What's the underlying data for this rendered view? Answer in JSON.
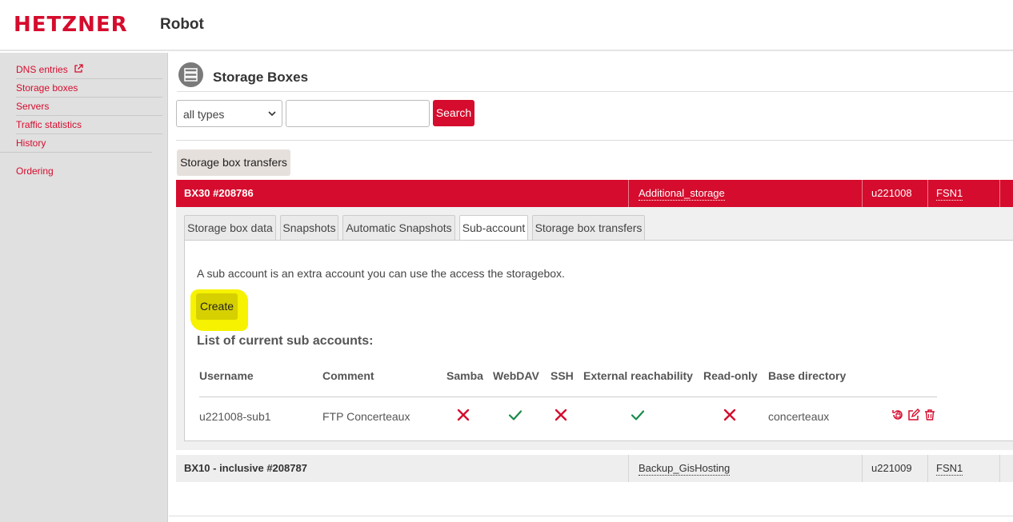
{
  "header": {
    "logo": "HETZNER",
    "product": "Robot"
  },
  "sidebar": {
    "items": [
      {
        "label": "DNS entries"
      },
      {
        "label": "Storage boxes"
      },
      {
        "label": "Servers"
      },
      {
        "label": "Traffic statistics"
      },
      {
        "label": "History"
      },
      {
        "label": "Ordering"
      }
    ]
  },
  "page": {
    "title": "Storage Boxes",
    "icon": "server-stack-icon"
  },
  "filter": {
    "type_selected": "all types",
    "search_value": "",
    "search_label": "Search"
  },
  "transfers_button": "Storage box transfers",
  "boxes": [
    {
      "title": "BX30 #208786",
      "name": "Additional_storage",
      "user": "u221008",
      "location": "FSN1"
    },
    {
      "title": "BX10 - inclusive #208787",
      "name": "Backup_GisHosting",
      "user": "u221009",
      "location": "FSN1"
    }
  ],
  "tabs": [
    {
      "label": "Storage box data"
    },
    {
      "label": "Snapshots"
    },
    {
      "label": "Automatic Snapshots"
    },
    {
      "label": "Sub-account",
      "active": true
    },
    {
      "label": "Storage box transfers"
    }
  ],
  "subaccount": {
    "description": "A sub account is an extra account you can use the access the storagebox.",
    "create_label": "Create",
    "list_title": "List of current sub accounts:",
    "columns": [
      "Username",
      "Comment",
      "Samba",
      "WebDAV",
      "SSH",
      "External reachability",
      "Read-only",
      "Base directory"
    ],
    "rows": [
      {
        "username": "u221008-sub1",
        "comment": "FTP Concerteaux",
        "samba": false,
        "webdav": true,
        "ssh": false,
        "external": true,
        "readonly": false,
        "base_directory": "concerteaux"
      }
    ]
  },
  "colors": {
    "brand": "#d50c2d",
    "check": "#1a8a4a",
    "highlight": "#f6f200"
  }
}
